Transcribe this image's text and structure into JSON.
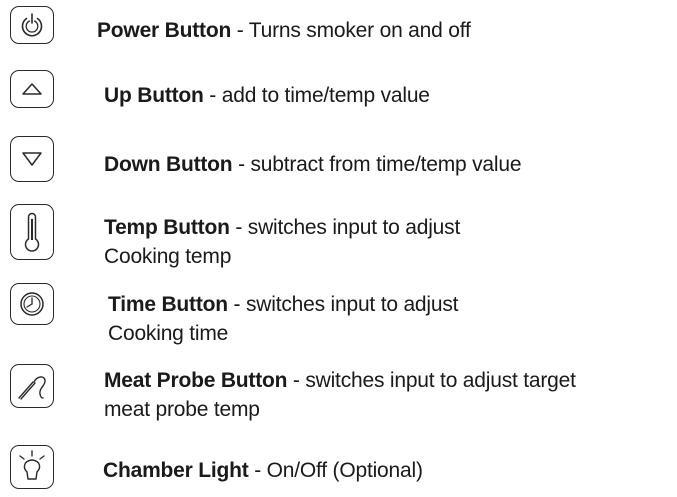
{
  "buttons": [
    {
      "icon": "power-icon",
      "name": "Power Button",
      "line1": " - Turns smoker on and off",
      "line2": ""
    },
    {
      "icon": "up-arrow-icon",
      "name": "Up Button",
      "line1": " - add to time/temp value",
      "line2": ""
    },
    {
      "icon": "down-arrow-icon",
      "name": "Down Button",
      "line1": " - subtract from time/temp value",
      "line2": ""
    },
    {
      "icon": "thermometer-icon",
      "name": "Temp Button",
      "line1": " - switches input to adjust",
      "line2": "Cooking temp"
    },
    {
      "icon": "clock-icon",
      "name": "Time Button",
      "line1": " - switches input to adjust",
      "line2": "Cooking time"
    },
    {
      "icon": "meat-probe-icon",
      "name": "Meat Probe Button",
      "line1": " - switches input to adjust target",
      "line2": "meat probe temp"
    },
    {
      "icon": "light-bulb-icon",
      "name": "Chamber Light",
      "line1": " - On/Off (Optional)",
      "line2": ""
    }
  ]
}
